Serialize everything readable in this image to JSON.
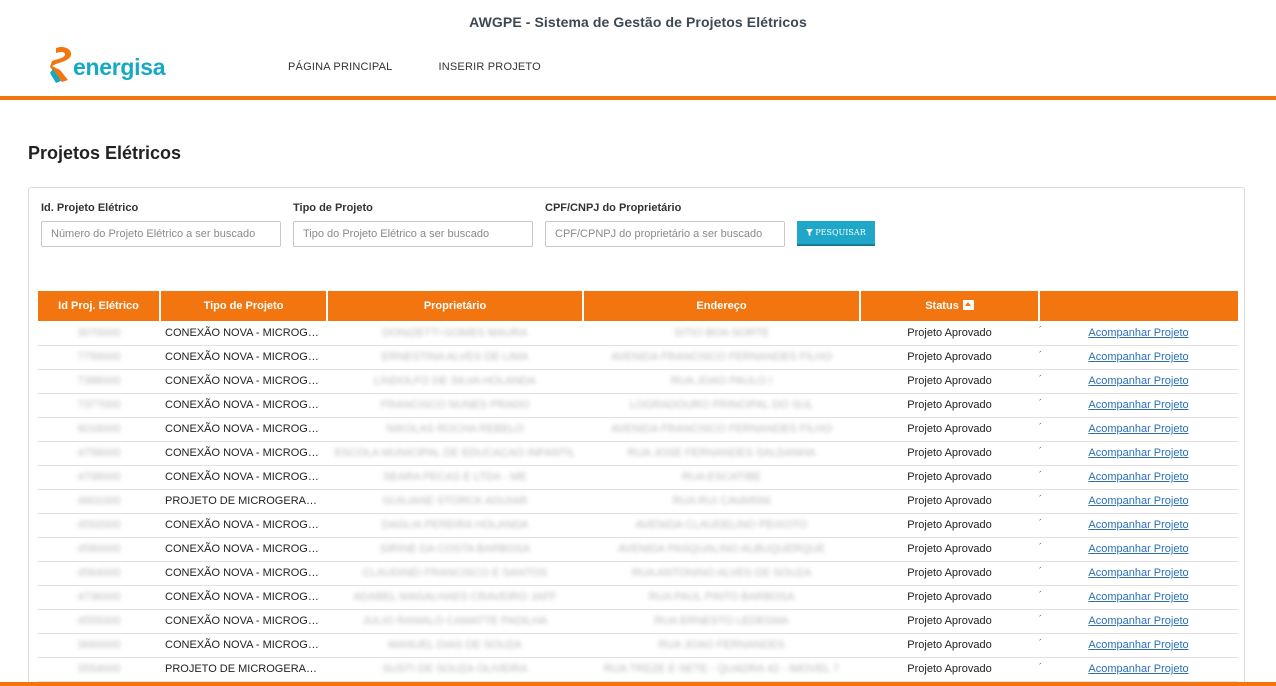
{
  "app": {
    "title": "AWGPE - Sistema de Gestão de Projetos Elétricos"
  },
  "brand": {
    "name": "energisa",
    "primary_color": "#f2750f",
    "secondary_color": "#16a9c4"
  },
  "nav": {
    "items": [
      {
        "label": "PÁGINA PRINCIPAL"
      },
      {
        "label": "INSERIR PROJETO"
      }
    ]
  },
  "page": {
    "title": "Projetos Elétricos"
  },
  "filters": {
    "id": {
      "label": "Id. Projeto Elétrico",
      "placeholder": "Número do Projeto Elétrico a ser buscado",
      "value": ""
    },
    "type": {
      "label": "Tipo de Projeto",
      "placeholder": "Tipo do Projeto Elétrico a ser buscado",
      "value": ""
    },
    "doc": {
      "label": "CPF/CNPJ do Proprietário",
      "placeholder": "CPF/CPNPJ do proprietário a ser buscado",
      "value": ""
    },
    "search_label": "PESQUISAR",
    "search_icon": "filter-icon"
  },
  "table": {
    "headers": [
      "Id Proj. Elétrico",
      "Tipo de Projeto",
      "Proprietário",
      "Endereço",
      "Status",
      ""
    ],
    "sort_column": "Status",
    "rows": [
      {
        "id": "3070000",
        "type": "CONEXÃO NOVA - MICROGERAÇÃO",
        "owner": "DONIZETTI GOMES MAURA",
        "address": "SITIO BOA SORTE",
        "status": "Projeto Aprovado",
        "action": "Acompanhar Projeto"
      },
      {
        "id": "7759000",
        "type": "CONEXÃO NOVA - MICROGERAÇÃO",
        "owner": "ERNESTINA ALVES DE LIMA",
        "address": "AVENIDA FRANCISCO FERNANDES FILHO",
        "status": "Projeto Aprovado",
        "action": "Acompanhar Projeto"
      },
      {
        "id": "7388000",
        "type": "CONEXÃO NOVA - MICROGERAÇÃO",
        "owner": "LINDOLFO DE SILVA HOLANDA",
        "address": "RUA JOAO PAULO I",
        "status": "Projeto Aprovado",
        "action": "Acompanhar Projeto"
      },
      {
        "id": "7377000",
        "type": "CONEXÃO NOVA - MICROGERAÇÃO",
        "owner": "FRANCISCO NUNES PRADO",
        "address": "LOGRADOURO PRINCIPAL DO SUL",
        "status": "Projeto Aprovado",
        "action": "Acompanhar Projeto"
      },
      {
        "id": "6016000",
        "type": "CONEXÃO NOVA - MICROGERAÇÃO",
        "owner": "NIKOLAS ROCHA REBELO",
        "address": "AVENIDA FRANCISCO FERNANDES FILHO",
        "status": "Projeto Aprovado",
        "action": "Acompanhar Projeto"
      },
      {
        "id": "4758000",
        "type": "CONEXÃO NOVA - MICROGERAÇÃO",
        "owner": "ESCOLA MUNICIPAL DE EDUCACAO INFANTIL",
        "address": "RUA JOSE FERNANDES SALDANHA",
        "status": "Projeto Aprovado",
        "action": "Acompanhar Projeto"
      },
      {
        "id": "4708000",
        "type": "CONEXÃO NOVA - MICROGERAÇÃO",
        "owner": "SEARA PECAS E LTDA - ME",
        "address": "RUA ESCATIBE",
        "status": "Projeto Aprovado",
        "action": "Acompanhar Projeto"
      },
      {
        "id": "4601000",
        "type": "PROJETO DE MICROGERAÇÃO - BAIXA TENSÃO",
        "owner": "GUILIANE STORCK AGUIAR",
        "address": "RUA RUI CAVARINI",
        "status": "Projeto Aprovado",
        "action": "Acompanhar Projeto"
      },
      {
        "id": "4592000",
        "type": "CONEXÃO NOVA - MICROGERAÇÃO",
        "owner": "DAGLIA PEREIRA HOLANDA",
        "address": "AVENIDA CLAUDELINO PEIXOTO",
        "status": "Projeto Aprovado",
        "action": "Acompanhar Projeto"
      },
      {
        "id": "4580000",
        "type": "CONEXÃO NOVA - MICROGERAÇÃO",
        "owner": "SIRINE DA COSTA BARBOSA",
        "address": "AVENIDA PASQUALINO ALBUQUERQUE",
        "status": "Projeto Aprovado",
        "action": "Acompanhar Projeto"
      },
      {
        "id": "4564000",
        "type": "CONEXÃO NOVA - MICROGERAÇÃO",
        "owner": "CLAUDINEI FRANCISCO E SANTOS",
        "address": "RUA ANTONINO ALVES DE SOUZA",
        "status": "Projeto Aprovado",
        "action": "Acompanhar Projeto"
      },
      {
        "id": "4736000",
        "type": "CONEXÃO NOVA - MICROGERAÇÃO",
        "owner": "ADABEL MAGALHAES CRAVEIRO JAFF",
        "address": "RUA PAUL PINTO BARBOSA",
        "status": "Projeto Aprovado",
        "action": "Acompanhar Projeto"
      },
      {
        "id": "4555000",
        "type": "CONEXÃO NOVA - MICROGERAÇÃO",
        "owner": "JULIO RAMALO CAMATTE PADILHA",
        "address": "RUA ERNESTO LEDESMA",
        "status": "Projeto Aprovado",
        "action": "Acompanhar Projeto"
      },
      {
        "id": "3660000",
        "type": "CONEXÃO NOVA - MICROGERAÇÃO",
        "owner": "MANUEL DIAS DE SOUZA",
        "address": "RUA JOAO FERNANDES",
        "status": "Projeto Aprovado",
        "action": "Acompanhar Projeto"
      },
      {
        "id": "3554000",
        "type": "PROJETO DE MICROGERAÇÃO - BAIXA TENSÃO",
        "owner": "SUSTI DE SOUZA OLIVEIRA",
        "address": "RUA TREZE E SETE - QUADRA 42 - IMOVEL 7",
        "status": "Projeto Aprovado",
        "action": "Acompanhar Projeto"
      }
    ]
  }
}
